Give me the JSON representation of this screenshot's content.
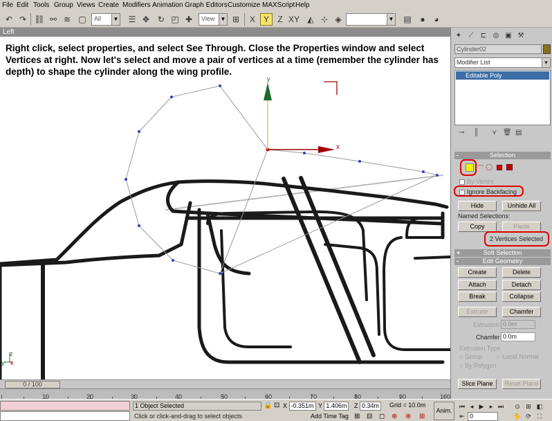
{
  "menu": [
    "File",
    "Edit",
    "Tools",
    "Group",
    "Views",
    "Create",
    "Modifiers",
    "Animation",
    "Graph Editors",
    "Customize",
    "MAXScript",
    "Help"
  ],
  "toolbar": {
    "selection_filter": "All",
    "ref_coord": "View",
    "named_sel": "",
    "icons": [
      "undo-icon",
      "redo-icon",
      "select-link-icon",
      "unlink-icon",
      "bind-spacewarp-icon",
      "selection-filter-dropdown",
      "select-object-icon",
      "select-by-name-icon",
      "region-select-icon",
      "window-crossing-icon",
      "select-move-icon",
      "select-rotate-icon",
      "select-scale-icon",
      "ref-coord-dropdown",
      "pivot-center-icon",
      "mirror-icon",
      "align-icon",
      "named-selection-dropdown",
      "layer-manager-icon",
      "curve-editor-icon",
      "schematic-icon",
      "material-editor-icon",
      "render-icon"
    ]
  },
  "viewport": {
    "label": "Left",
    "instructions": "Right click, select properties, and select See Through.  Close the Properties window and select Vertices at right.  Now let's select and move a pair of vertices at a time (remember the cylinder has depth) to shape the cylinder along the wing profile.",
    "gizmo_y": "y",
    "gizmo_x": "x",
    "axis_z": "z",
    "axis_y": "y",
    "axis_x": "x"
  },
  "command_panel": {
    "object_name": "Cylinder02",
    "object_color": "#8a6f1b",
    "modifier_list": "Modifier List",
    "stack_item": "Editable Poly",
    "selection": {
      "title": "Selection",
      "by_vertex": "By Vertex",
      "ignore_backfacing": "Ignore Backfacing",
      "hide": "Hide",
      "unhide_all": "Unhide All",
      "named_selections": "Named Selections:",
      "copy": "Copy",
      "paste": "Paste",
      "status": "2 Vertices Selected"
    },
    "soft_selection": {
      "title": "Soft Selection",
      "toggle": "+"
    },
    "edit_geometry": {
      "title": "Edit Geometry",
      "toggle": "-",
      "create": "Create",
      "delete": "Delete",
      "attach": "Attach",
      "detach": "Detach",
      "break": "Break",
      "collapse": "Collapse",
      "extrude": "Extrude",
      "chamfer_btn": "Chamfer",
      "extrusion_label": "Extrusion",
      "extrusion_value": "0.0m",
      "chamfer_label": "Chamfer",
      "chamfer_value": "0.0m",
      "extrusion_type": "Extrusion Type",
      "group": "Group",
      "local_normal": "Local Normal",
      "by_polygon": "By Polygon",
      "slice_plane": "Slice Plane",
      "reset_plane": "Reset Plane"
    },
    "selection_toggle": "-",
    "accent_red": "#e00000"
  },
  "timeline": {
    "slider": "0 / 100",
    "ticks": [
      "10",
      "20",
      "30",
      "40",
      "50",
      "60",
      "70",
      "80",
      "90",
      "100"
    ]
  },
  "status": {
    "selected": "1 Object Selected",
    "prompt": "Click or click-and-drag to select objects",
    "x_label": "X",
    "x_value": "-0.351m",
    "y_label": "Y",
    "y_value": "1.406m",
    "z_label": "Z",
    "z_value": "0.34m",
    "grid": "Grid = 10.0m",
    "add_time_tag": "Add Time Tag",
    "anim": "Anim.",
    "frame": "0"
  }
}
